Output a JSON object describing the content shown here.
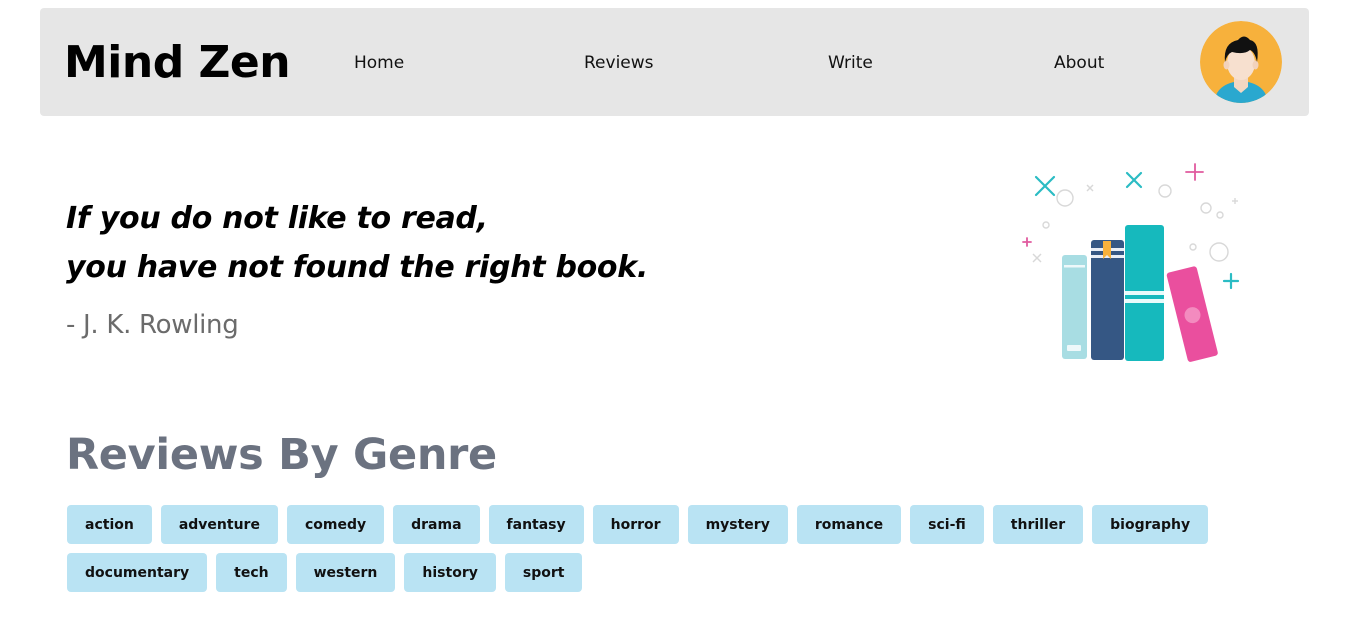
{
  "nav": {
    "brand": "Mind Zen",
    "links": [
      "Home",
      "Reviews",
      "Write",
      "About"
    ]
  },
  "hero": {
    "quote_line1": "If you do not like to read,",
    "quote_line2": "you have not found the right book.",
    "author": "- J. K. Rowling"
  },
  "genres": {
    "title": "Reviews By Genre",
    "tags": [
      "action",
      "adventure",
      "comedy",
      "drama",
      "fantasy",
      "horror",
      "mystery",
      "romance",
      "sci-fi",
      "thriller",
      "biography",
      "documentary",
      "tech",
      "western",
      "history",
      "sport"
    ]
  },
  "icons": {
    "avatar": "user-avatar-icon",
    "illustration": "books-illustration"
  },
  "colors": {
    "navbar_bg": "#e6e6e6",
    "tag_bg": "#b9e3f3",
    "title_gray": "#6b7280",
    "avatar_bg": "#f7b13c"
  }
}
